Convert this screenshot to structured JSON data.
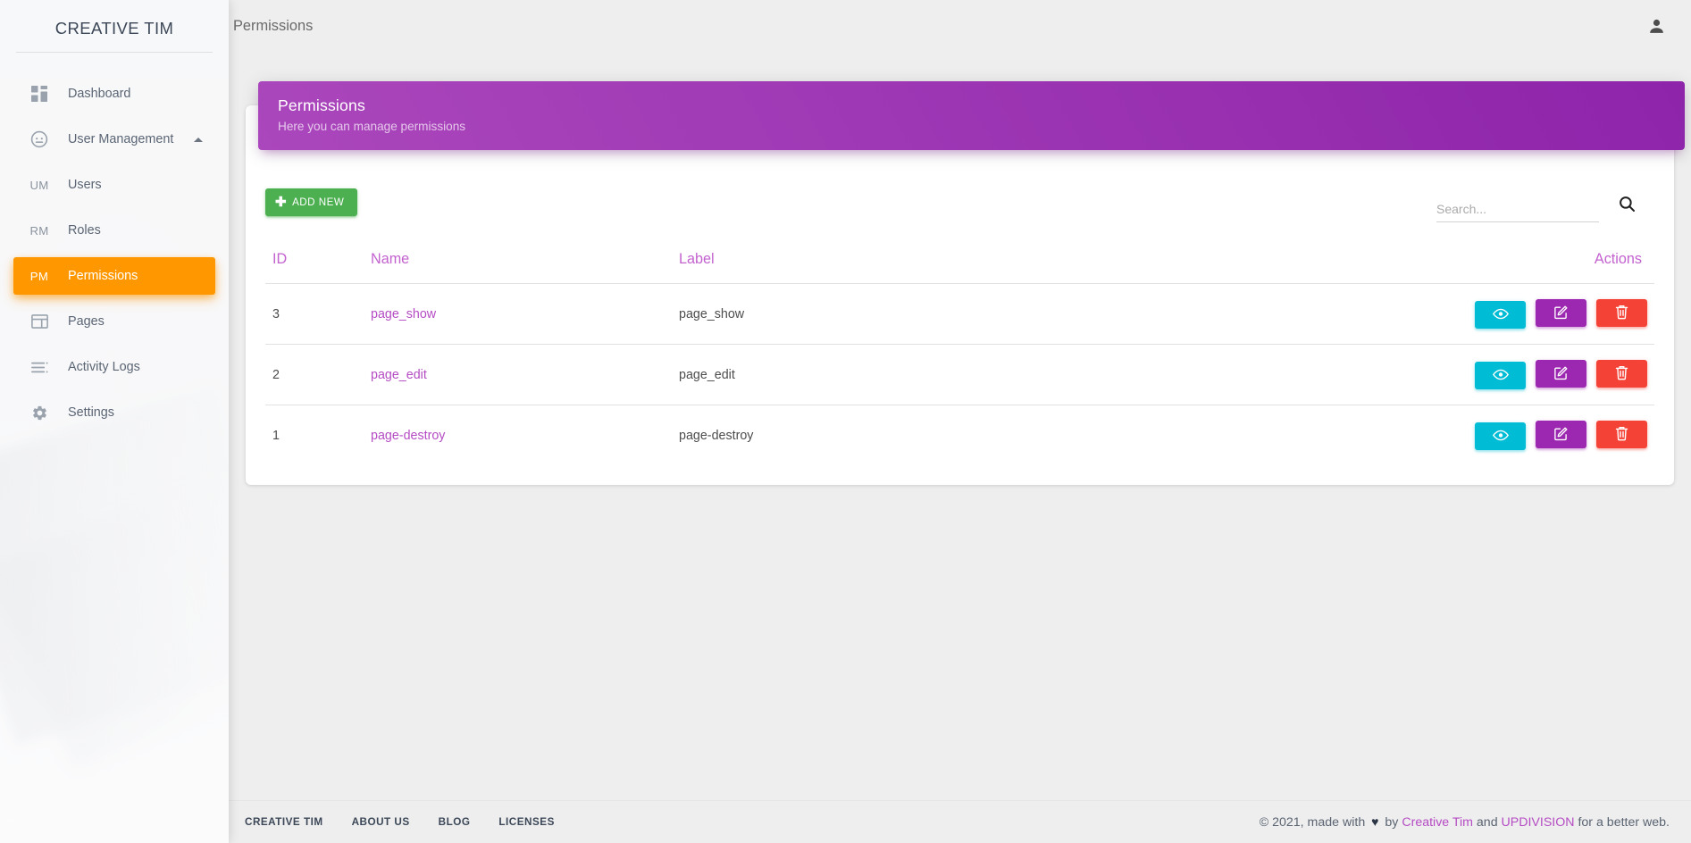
{
  "sidebar": {
    "brand": "CREATIVE TIM",
    "items": [
      {
        "label": "Dashboard",
        "icon": "dashboard-grid-icon",
        "type": "icon",
        "active": false
      },
      {
        "label": "User Management",
        "icon": "user-circle-icon",
        "type": "icon",
        "active": false,
        "caret": "chevron-up-icon"
      },
      {
        "label": "Users",
        "abbr": "UM",
        "type": "abbr",
        "active": false
      },
      {
        "label": "Roles",
        "abbr": "RM",
        "type": "abbr",
        "active": false
      },
      {
        "label": "Permissions",
        "abbr": "PM",
        "type": "abbr",
        "active": true
      },
      {
        "label": "Pages",
        "icon": "layout-icon",
        "type": "icon",
        "active": false
      },
      {
        "label": "Activity Logs",
        "icon": "list-lines-icon",
        "type": "icon",
        "active": false
      },
      {
        "label": "Settings",
        "icon": "gear-icon",
        "type": "icon",
        "active": false
      }
    ]
  },
  "topbar": {
    "page_title": "Permissions",
    "user_icon": "person-icon"
  },
  "card": {
    "header_title": "Permissions",
    "header_subtitle": "Here you can manage permissions"
  },
  "toolbar": {
    "add_label": "ADD NEW",
    "add_icon": "plus-icon",
    "search_placeholder": "Search...",
    "search_value": "",
    "search_icon": "search-icon"
  },
  "table": {
    "columns": [
      "ID",
      "Name",
      "Label",
      "Actions"
    ],
    "rows": [
      {
        "id": "3",
        "name": "page_show",
        "label": "page_show"
      },
      {
        "id": "2",
        "name": "page_edit",
        "label": "page_edit"
      },
      {
        "id": "1",
        "name": "page-destroy",
        "label": "page-destroy"
      }
    ],
    "actions": {
      "view_icon": "eye-icon",
      "edit_icon": "pencil-square-icon",
      "delete_icon": "trash-icon"
    }
  },
  "footer": {
    "links": [
      "CREATIVE TIM",
      "ABOUT US",
      "BLOG",
      "LICENSES"
    ],
    "copy_prefix": "© 2021, made with ",
    "heart": "♥",
    "copy_by": " by ",
    "brand_link": "Creative Tim",
    "copy_and": " and ",
    "partner_link": "UPDIVISION",
    "copy_suffix": " for a better web."
  },
  "colors": {
    "accent_orange": "#ff9800",
    "accent_purple": "#9c27b0",
    "purple_light": "#ab47bc",
    "link_purple": "#b54cc4",
    "green": "#4caf50",
    "cyan": "#00bcd4",
    "red": "#f44336",
    "page_bg": "#eeeeee"
  }
}
